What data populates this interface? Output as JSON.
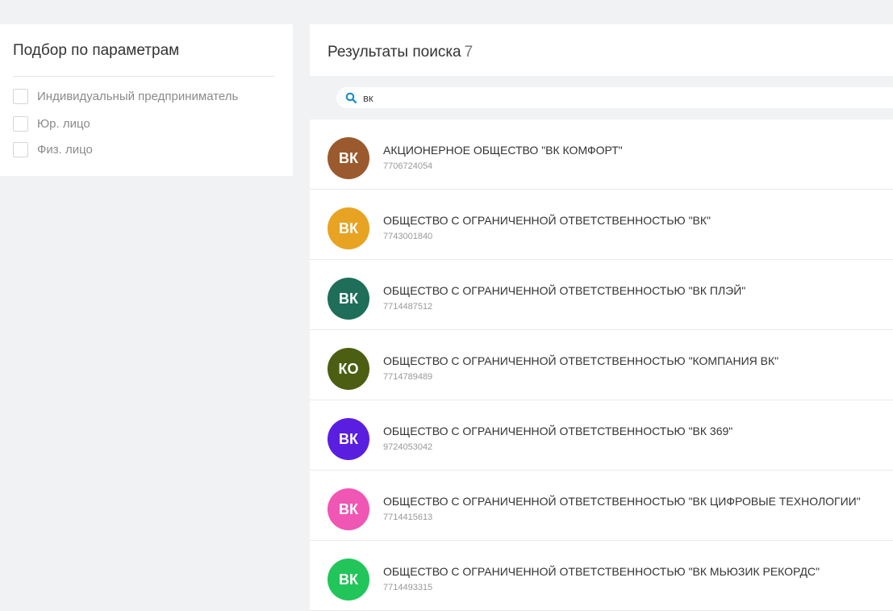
{
  "filters": {
    "title": "Подбор по параметрам",
    "options": [
      {
        "label": "Индивидуальный предприниматель",
        "checked": false
      },
      {
        "label": "Юр. лицо",
        "checked": false
      },
      {
        "label": "Физ. лицо",
        "checked": false
      }
    ]
  },
  "results": {
    "title": "Результаты поиска",
    "count": "7",
    "search_value": "вк",
    "items": [
      {
        "initials": "ВК",
        "name": "АКЦИОНЕРНОЕ ОБЩЕСТВО \"ВК КОМФОРТ\"",
        "inn": "7706724054",
        "color": "#9b5a2e"
      },
      {
        "initials": "ВК",
        "name": "ОБЩЕСТВО С ОГРАНИЧЕННОЙ ОТВЕТСТВЕННОСТЬЮ \"ВК\"",
        "inn": "7743001840",
        "color": "#e8a322"
      },
      {
        "initials": "ВК",
        "name": "ОБЩЕСТВО С ОГРАНИЧЕННОЙ ОТВЕТСТВЕННОСТЬЮ \"ВК ПЛЭЙ\"",
        "inn": "7714487512",
        "color": "#1e6e5a"
      },
      {
        "initials": "КО",
        "name": "ОБЩЕСТВО С ОГРАНИЧЕННОЙ ОТВЕТСТВЕННОСТЬЮ \"КОМПАНИЯ ВК\"",
        "inn": "7714789489",
        "color": "#4b5e12"
      },
      {
        "initials": "ВК",
        "name": "ОБЩЕСТВО С ОГРАНИЧЕННОЙ ОТВЕТСТВЕННОСТЬЮ \"ВК 369\"",
        "inn": "9724053042",
        "color": "#5a1ee0"
      },
      {
        "initials": "ВК",
        "name": "ОБЩЕСТВО С ОГРАНИЧЕННОЙ ОТВЕТСТВЕННОСТЬЮ \"ВК ЦИФРОВЫЕ ТЕХНОЛОГИИ\"",
        "inn": "7714415613",
        "color": "#f056b4"
      },
      {
        "initials": "ВК",
        "name": "ОБЩЕСТВО С ОГРАНИЧЕННОЙ ОТВЕТСТВЕННОСТЬЮ \"ВК МЬЮЗИК РЕКОРДС\"",
        "inn": "7714493315",
        "color": "#22c55a"
      }
    ]
  },
  "icons": {
    "search": "search-icon"
  },
  "colors": {
    "accent": "#1a8fc9"
  }
}
